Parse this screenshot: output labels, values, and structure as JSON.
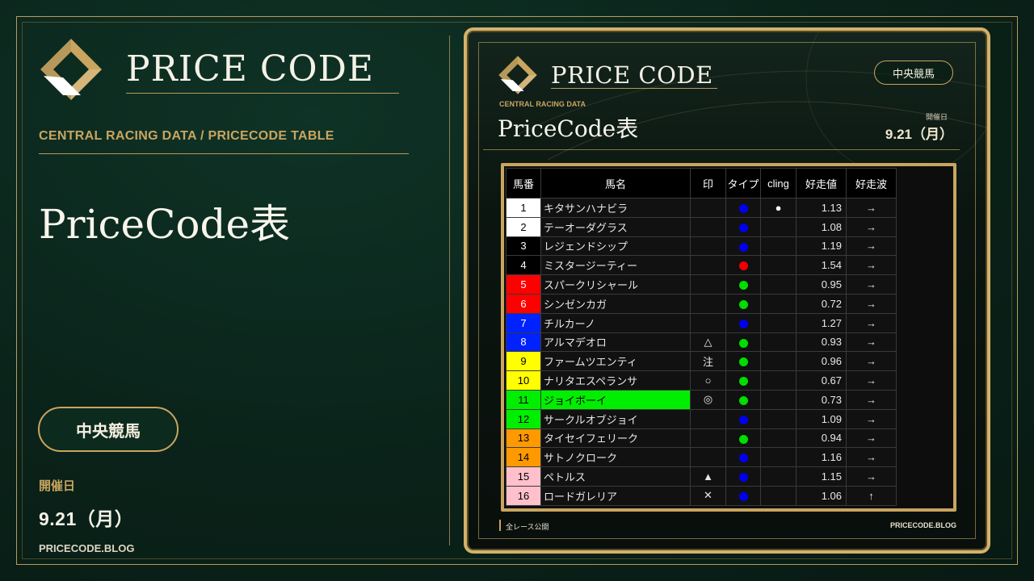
{
  "left": {
    "brand": "PRICE CODE",
    "subtitle": "CENTRAL RACING DATA / PRICECODE TABLE",
    "title": "PriceCode表",
    "region_badge": "中央競馬",
    "date_label": "開催日",
    "date_value": "9.21（月）",
    "blog": "PRICECODE.BLOG"
  },
  "card": {
    "brand": "PRICE CODE",
    "region_badge": "中央競馬",
    "subtitle": "CENTRAL RACING DATA",
    "title": "PriceCode表",
    "date_label": "開催日",
    "date_value": "9.21（月）",
    "footer_left": "全レース公開",
    "footer_right": "PRICECODE.BLOG"
  },
  "table": {
    "headers": [
      "馬番",
      "馬名",
      "印",
      "タイプ",
      "cling",
      "好走値",
      "好走波"
    ],
    "rows": [
      {
        "num": "1",
        "num_bg": "#ffffff",
        "num_fg": "#000000",
        "name": "キタサンハナビラ",
        "mark": "",
        "type_color": "#0000ee",
        "cling": "●",
        "value": "1.13",
        "wave": "→",
        "highlight": false
      },
      {
        "num": "2",
        "num_bg": "#ffffff",
        "num_fg": "#000000",
        "name": "テーオーダグラス",
        "mark": "",
        "type_color": "#0000ee",
        "cling": "",
        "value": "1.08",
        "wave": "→",
        "highlight": false
      },
      {
        "num": "3",
        "num_bg": "#000000",
        "num_fg": "#ffffff",
        "name": "レジェンドシップ",
        "mark": "",
        "type_color": "#0000ee",
        "cling": "",
        "value": "1.19",
        "wave": "→",
        "highlight": false
      },
      {
        "num": "4",
        "num_bg": "#000000",
        "num_fg": "#ffffff",
        "name": "ミスタージーティー",
        "mark": "",
        "type_color": "#ee0000",
        "cling": "",
        "value": "1.54",
        "wave": "→",
        "highlight": false
      },
      {
        "num": "5",
        "num_bg": "#ff0000",
        "num_fg": "#ffffff",
        "name": "スパークリシャール",
        "mark": "",
        "type_color": "#00dd00",
        "cling": "",
        "value": "0.95",
        "wave": "→",
        "highlight": false
      },
      {
        "num": "6",
        "num_bg": "#ff0000",
        "num_fg": "#ffffff",
        "name": "シンゼンカガ",
        "mark": "",
        "type_color": "#00dd00",
        "cling": "",
        "value": "0.72",
        "wave": "→",
        "highlight": false
      },
      {
        "num": "7",
        "num_bg": "#0022ff",
        "num_fg": "#ffffff",
        "name": "チルカーノ",
        "mark": "",
        "type_color": "#0000ee",
        "cling": "",
        "value": "1.27",
        "wave": "→",
        "highlight": false
      },
      {
        "num": "8",
        "num_bg": "#0022ff",
        "num_fg": "#ffffff",
        "name": "アルマデオロ",
        "mark": "△",
        "type_color": "#00dd00",
        "cling": "",
        "value": "0.93",
        "wave": "→",
        "highlight": false
      },
      {
        "num": "9",
        "num_bg": "#ffff00",
        "num_fg": "#000000",
        "name": "ファームツエンティ",
        "mark": "注",
        "type_color": "#00dd00",
        "cling": "",
        "value": "0.96",
        "wave": "→",
        "highlight": false
      },
      {
        "num": "10",
        "num_bg": "#ffff00",
        "num_fg": "#000000",
        "name": "ナリタエスペランサ",
        "mark": "○",
        "type_color": "#00dd00",
        "cling": "",
        "value": "0.67",
        "wave": "→",
        "highlight": false
      },
      {
        "num": "11",
        "num_bg": "#00ee00",
        "num_fg": "#000000",
        "name": "ジョイボーイ",
        "mark": "◎",
        "type_color": "#00dd00",
        "cling": "",
        "value": "0.73",
        "wave": "→",
        "highlight": true
      },
      {
        "num": "12",
        "num_bg": "#00ee00",
        "num_fg": "#000000",
        "name": "サークルオブジョイ",
        "mark": "",
        "type_color": "#0000ee",
        "cling": "",
        "value": "1.09",
        "wave": "→",
        "highlight": false
      },
      {
        "num": "13",
        "num_bg": "#ff9900",
        "num_fg": "#000000",
        "name": "タイセイフェリーク",
        "mark": "",
        "type_color": "#00dd00",
        "cling": "",
        "value": "0.94",
        "wave": "→",
        "highlight": false
      },
      {
        "num": "14",
        "num_bg": "#ff9900",
        "num_fg": "#000000",
        "name": "サトノクローク",
        "mark": "",
        "type_color": "#0000ee",
        "cling": "",
        "value": "1.16",
        "wave": "→",
        "highlight": false
      },
      {
        "num": "15",
        "num_bg": "#ffc0cb",
        "num_fg": "#000000",
        "name": "ペトルス",
        "mark": "▲",
        "type_color": "#0000ee",
        "cling": "",
        "value": "1.15",
        "wave": "→",
        "highlight": false
      },
      {
        "num": "16",
        "num_bg": "#ffc0cb",
        "num_fg": "#000000",
        "name": "ロードガレリア",
        "mark": "✕",
        "type_color": "#0000ee",
        "cling": "",
        "value": "1.06",
        "wave": "↑",
        "highlight": false
      }
    ]
  },
  "colors": {
    "background": "#0a2219",
    "gold": "#c9a560",
    "highlight_row": "#00ee00"
  },
  "icons": [
    "price-code-logo-icon"
  ]
}
